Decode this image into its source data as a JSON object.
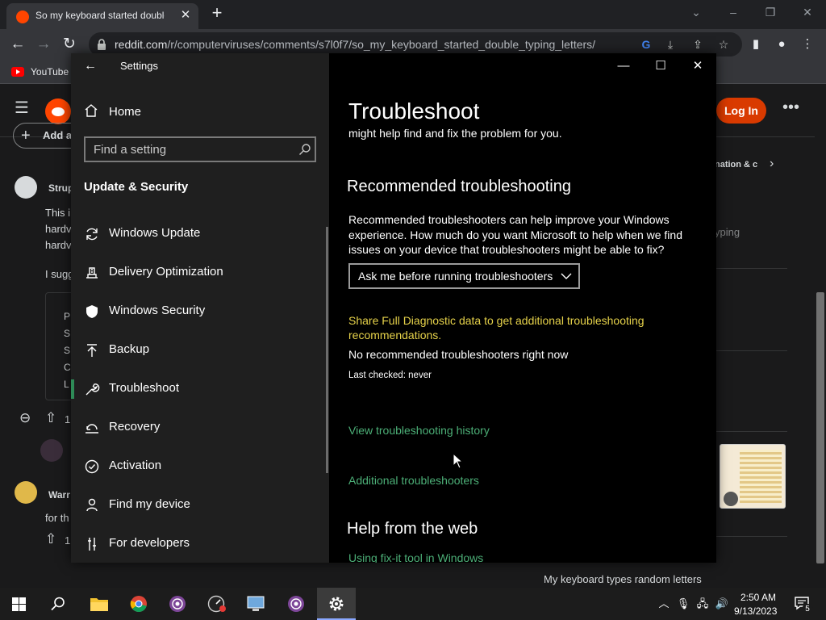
{
  "browser": {
    "tab_title": "So my keyboard started double t",
    "tab_close": "✕",
    "new_tab": "+",
    "url_host": "reddit.com",
    "url_path": "/r/computerviruses/comments/s7l0f7/so_my_keyboard_started_double_typing_letters/",
    "bookmark_youtube": "YouTube",
    "controls": {
      "minimize": "–",
      "restore": "❐",
      "close": "✕",
      "tab_search": "⌄"
    },
    "icons": {
      "back": "←",
      "forward": "→",
      "reload": "↻",
      "google_lens": "G",
      "install": "⤓",
      "share": "⇪",
      "bookmark_star": "☆",
      "side_panel": "▮",
      "profile": "●",
      "menu": "⋮"
    }
  },
  "reddit": {
    "menu_glyph": "☰",
    "login_label": "Log In",
    "more_glyph": "•••",
    "add_label": "Add a",
    "comment1": {
      "author": "Strup",
      "lines": [
        "This i",
        "hardv",
        "hardv"
      ],
      "line4": "I sugg"
    },
    "box_lines": [
      "P",
      "S",
      "S",
      "C",
      "L"
    ],
    "vote1": "1",
    "comment2": {
      "author": "Warr",
      "line": "for th",
      "vote": "1"
    },
    "right_item1": "nation & c",
    "right_item1_chevron": "›",
    "right_item2": "yping",
    "bottom_title": "My keyboard types random letters",
    "collapse_glyph": "⊖",
    "upvote_glyph": "⇧"
  },
  "settings": {
    "window_title": "Settings",
    "back_glyph": "←",
    "win_min": "—",
    "win_max": "☐",
    "win_close": "✕",
    "home_label": "Home",
    "search_placeholder": "Find a setting",
    "section_title": "Update & Security",
    "nav": [
      {
        "label": "Windows Update",
        "icon": "sync-icon"
      },
      {
        "label": "Delivery Optimization",
        "icon": "delivery-icon"
      },
      {
        "label": "Windows Security",
        "icon": "shield-icon"
      },
      {
        "label": "Backup",
        "icon": "backup-arrow-icon"
      },
      {
        "label": "Troubleshoot",
        "icon": "wrench-icon"
      },
      {
        "label": "Recovery",
        "icon": "recovery-icon"
      },
      {
        "label": "Activation",
        "icon": "check-circle-icon"
      },
      {
        "label": "Find my device",
        "icon": "person-pin-icon"
      },
      {
        "label": "For developers",
        "icon": "developer-tools-icon"
      }
    ],
    "active_nav": "Troubleshoot",
    "accent_color": "#2e8b57",
    "content": {
      "title": "Troubleshoot",
      "intro_tail": "might help find and fix the problem for you.",
      "rec_heading": "Recommended troubleshooting",
      "rec_desc": "Recommended troubleshooters can help improve your Windows experience. How much do you want Microsoft to help when we find issues on your device that troubleshooters might be able to fix?",
      "dropdown_value": "Ask me before running troubleshooters",
      "diag_link": "Share Full Diagnostic data to get additional troubleshooting recommendations.",
      "no_rec": "No recommended troubleshooters right now",
      "last_checked": "Last checked: never",
      "history_link": "View troubleshooting history",
      "additional_link": "Additional troubleshooters",
      "web_heading": "Help from the web",
      "fixit_link": "Using fix-it tool in Windows",
      "link_color": "#4caf77",
      "warning_color": "#e6d24a"
    }
  },
  "taskbar": {
    "time": "2:50 AM",
    "date": "9/13/2023",
    "notification_count": "5",
    "tray": {
      "chevron": "︿",
      "mic": "🎙",
      "network": "🖧",
      "volume": "🔊"
    }
  }
}
